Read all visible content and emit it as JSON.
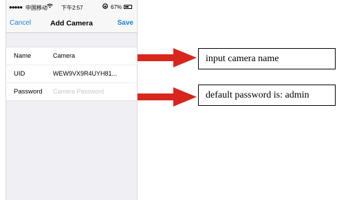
{
  "statusbar": {
    "signal": "●●●●●",
    "carrier": "中国移动",
    "time": "下午2:57",
    "battery_percent": "67%",
    "battery_level": 0.67
  },
  "navbar": {
    "cancel": "Cancel",
    "title": "Add Camera",
    "save": "Save"
  },
  "form": {
    "name_label": "Name",
    "name_value": "Camera",
    "uid_label": "UID",
    "uid_value": "WEW9VX9R4UYH81...",
    "password_label": "Password",
    "password_placeholder": "Camera Password"
  },
  "annotations": {
    "name_note": "input camera name",
    "password_note": "default password is: admin",
    "arrow_color": "#d9261c"
  }
}
